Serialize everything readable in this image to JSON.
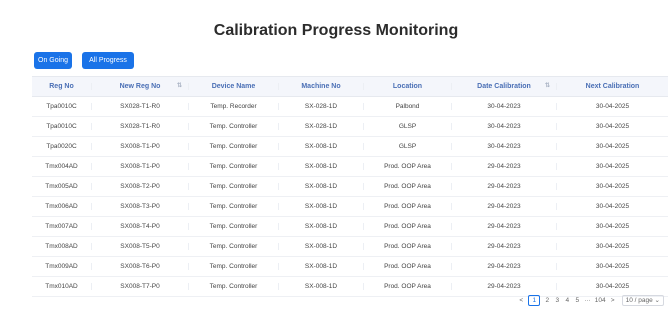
{
  "title": "Calibration Progress Monitoring",
  "toolbar": {
    "ongoing_label": "On Going",
    "all_progress_label": "All Progress"
  },
  "table": {
    "headers": [
      "Reg No",
      "New Reg No",
      "Device Name",
      "Machine No",
      "Location",
      "Date Calibration",
      "Next Calibration"
    ],
    "rows": [
      [
        "Tpa0010C",
        "SX028-T1-R0",
        "Temp. Recorder",
        "SX-028-1D",
        "Palbond",
        "30-04-2023",
        "30-04-2025"
      ],
      [
        "Tpa0010C",
        "SX028-T1-R0",
        "Temp. Controller",
        "SX-028-1D",
        "GLSP",
        "30-04-2023",
        "30-04-2025"
      ],
      [
        "Tpa0020C",
        "SX008-T1-P0",
        "Temp. Controller",
        "SX-008-1D",
        "GLSP",
        "30-04-2023",
        "30-04-2025"
      ],
      [
        "Tmx004AD",
        "SX008-T1-P0",
        "Temp. Controller",
        "SX-008-1D",
        "Prod. OOP Area",
        "29-04-2023",
        "30-04-2025"
      ],
      [
        "Tmx005AD",
        "SX008-T2-P0",
        "Temp. Controller",
        "SX-008-1D",
        "Prod. OOP Area",
        "29-04-2023",
        "30-04-2025"
      ],
      [
        "Tmx006AD",
        "SX008-T3-P0",
        "Temp. Controller",
        "SX-008-1D",
        "Prod. OOP Area",
        "29-04-2023",
        "30-04-2025"
      ],
      [
        "Tmx007AD",
        "SX008-T4-P0",
        "Temp. Controller",
        "SX-008-1D",
        "Prod. OOP Area",
        "29-04-2023",
        "30-04-2025"
      ],
      [
        "Tmx008AD",
        "SX008-T5-P0",
        "Temp. Controller",
        "SX-008-1D",
        "Prod. OOP Area",
        "29-04-2023",
        "30-04-2025"
      ],
      [
        "Tmx009AD",
        "SX008-T6-P0",
        "Temp. Controller",
        "SX-008-1D",
        "Prod. OOP Area",
        "29-04-2023",
        "30-04-2025"
      ],
      [
        "Tmx010AD",
        "SX008-T7-P0",
        "Temp. Controller",
        "SX-008-1D",
        "Prod. OOP Area",
        "29-04-2023",
        "30-04-2025"
      ]
    ]
  },
  "pagination": {
    "prev": "<",
    "pages": [
      "1",
      "2",
      "3",
      "4",
      "5"
    ],
    "ellipsis": "···",
    "last": "104",
    "next": ">",
    "page_size": "10 / page"
  },
  "colors": {
    "accent": "#1a73e8",
    "header_text": "#4a6fb5"
  }
}
